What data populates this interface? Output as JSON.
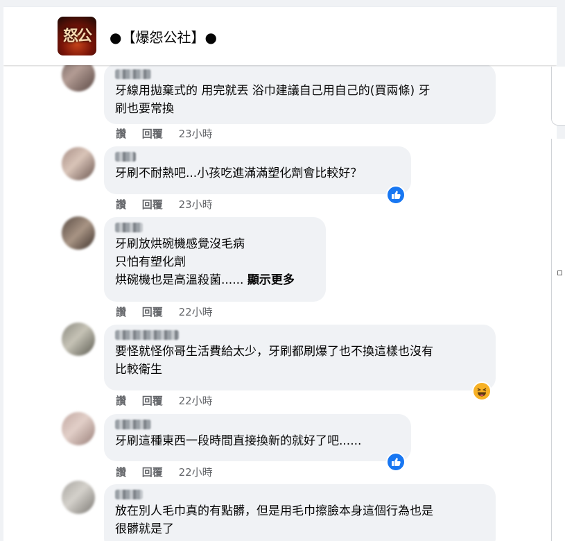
{
  "group": {
    "logo_text": "怒公",
    "name": "●【爆怨公社】●"
  },
  "comments": [
    {
      "text": "牙線用拋棄式的 用完就丟 浴巾建議自己用自己的(買兩條) 牙\n刷也要常換",
      "like_label": "讚",
      "reply_label": "回覆",
      "time": "23小時",
      "reaction": null
    },
    {
      "text": "牙刷不耐熱吧...小孩吃進滿滿塑化劑會比較好？",
      "like_label": "讚",
      "reply_label": "回覆",
      "time": "23小時",
      "reaction": "like-icon"
    },
    {
      "text": "牙刷放烘碗機感覺沒毛病\n只怕有塑化劑\n烘碗機也是高溫殺菌......",
      "see_more": "顯示更多",
      "like_label": "讚",
      "reply_label": "回覆",
      "time": "22小時",
      "reaction": null
    },
    {
      "text": "要怪就怪你哥生活費給太少，牙刷都刷爆了也不換這樣也沒有\n比較衛生",
      "like_label": "讚",
      "reply_label": "回覆",
      "time": "22小時",
      "reaction": "haha-icon"
    },
    {
      "text": "牙刷這種東西一段時間直接換新的就好了吧......",
      "like_label": "讚",
      "reply_label": "回覆",
      "time": "22小時",
      "reaction": "like-icon"
    },
    {
      "text": "放在別人毛巾真的有點髒，但是用毛巾擦臉本身這個行為也是\n很髒就是了",
      "reaction": null
    }
  ],
  "colors": {
    "like_blue": "#1877f2",
    "haha_yellow": "#f7b125",
    "bubble_bg": "#f0f2f5",
    "meta_gray": "#65676b"
  }
}
